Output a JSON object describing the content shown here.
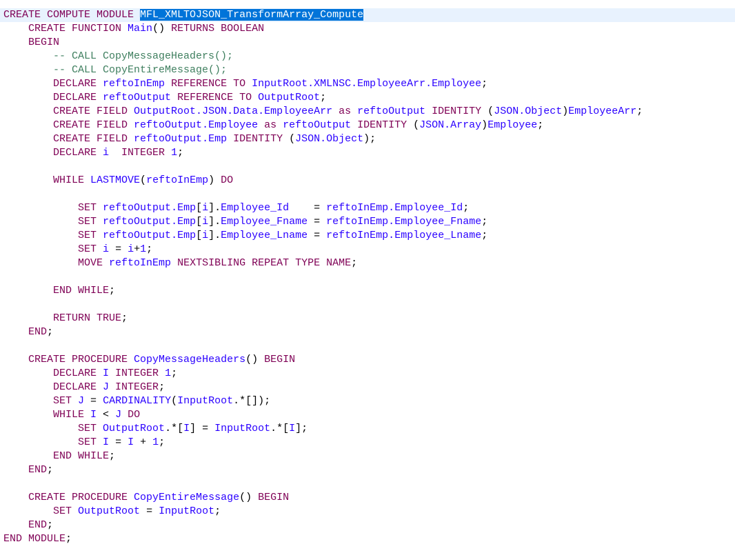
{
  "editor": {
    "language": "ESQL",
    "colors": {
      "keyword": "#7f0055",
      "identifier": "#2a00ff",
      "comment": "#3f7f5f",
      "punctuation": "#000000",
      "selection_bg": "#0074d9",
      "current_line_bg": "#e8f2fe"
    },
    "lines": [
      {
        "indent": 0,
        "current": true,
        "tokens": [
          [
            "kw",
            "CREATE COMPUTE MODULE "
          ],
          [
            "sel",
            "MFL_XMLTOJSON_TransformArray_Compute"
          ]
        ]
      },
      {
        "indent": 4,
        "tokens": [
          [
            "kw",
            "CREATE FUNCTION "
          ],
          [
            "id",
            "Main"
          ],
          [
            "pn",
            "() "
          ],
          [
            "kw",
            "RETURNS BOOLEAN"
          ]
        ]
      },
      {
        "indent": 4,
        "tokens": [
          [
            "kw",
            "BEGIN"
          ]
        ]
      },
      {
        "indent": 8,
        "tokens": [
          [
            "cm",
            "-- CALL CopyMessageHeaders();"
          ]
        ]
      },
      {
        "indent": 8,
        "tokens": [
          [
            "cm",
            "-- CALL CopyEntireMessage();"
          ]
        ]
      },
      {
        "indent": 8,
        "tokens": [
          [
            "kw",
            "DECLARE "
          ],
          [
            "id",
            "reftoInEmp "
          ],
          [
            "kw",
            "REFERENCE TO "
          ],
          [
            "id",
            "InputRoot.XMLNSC.EmployeeArr.Employee"
          ],
          [
            "pn",
            ";"
          ]
        ]
      },
      {
        "indent": 8,
        "tokens": [
          [
            "kw",
            "DECLARE "
          ],
          [
            "id",
            "reftoOutput "
          ],
          [
            "kw",
            "REFERENCE TO "
          ],
          [
            "id",
            "OutputRoot"
          ],
          [
            "pn",
            ";"
          ]
        ]
      },
      {
        "indent": 8,
        "tokens": [
          [
            "kw",
            "CREATE FIELD "
          ],
          [
            "id",
            "OutputRoot.JSON.Data.EmployeeArr "
          ],
          [
            "kw",
            "as "
          ],
          [
            "id",
            "reftoOutput "
          ],
          [
            "kw",
            "IDENTITY "
          ],
          [
            "pn",
            "("
          ],
          [
            "id",
            "JSON.Object"
          ],
          [
            "pn",
            ")"
          ],
          [
            "id",
            "EmployeeArr"
          ],
          [
            "pn",
            ";"
          ]
        ]
      },
      {
        "indent": 8,
        "tokens": [
          [
            "kw",
            "CREATE FIELD "
          ],
          [
            "id",
            "reftoOutput.Employee "
          ],
          [
            "kw",
            "as "
          ],
          [
            "id",
            "reftoOutput "
          ],
          [
            "kw",
            "IDENTITY "
          ],
          [
            "pn",
            "("
          ],
          [
            "id",
            "JSON.Array"
          ],
          [
            "pn",
            ")"
          ],
          [
            "id",
            "Employee"
          ],
          [
            "pn",
            ";"
          ]
        ]
      },
      {
        "indent": 8,
        "tokens": [
          [
            "kw",
            "CREATE FIELD "
          ],
          [
            "id",
            "reftoOutput.Emp "
          ],
          [
            "kw",
            "IDENTITY "
          ],
          [
            "pn",
            "("
          ],
          [
            "id",
            "JSON.Object"
          ],
          [
            "pn",
            ");"
          ]
        ]
      },
      {
        "indent": 8,
        "tokens": [
          [
            "kw",
            "DECLARE "
          ],
          [
            "id",
            "i  "
          ],
          [
            "kw",
            "INTEGER "
          ],
          [
            "num",
            "1"
          ],
          [
            "pn",
            ";"
          ]
        ]
      },
      {
        "indent": 0,
        "tokens": []
      },
      {
        "indent": 8,
        "tokens": [
          [
            "kw",
            "WHILE "
          ],
          [
            "id",
            "LASTMOVE"
          ],
          [
            "pn",
            "("
          ],
          [
            "id",
            "reftoInEmp"
          ],
          [
            "pn",
            ") "
          ],
          [
            "kw",
            "DO"
          ]
        ]
      },
      {
        "indent": 0,
        "tokens": []
      },
      {
        "indent": 12,
        "tokens": [
          [
            "kw",
            "SET "
          ],
          [
            "id",
            "reftoOutput.Emp"
          ],
          [
            "pn",
            "["
          ],
          [
            "id",
            "i"
          ],
          [
            "pn",
            "]."
          ],
          [
            "id",
            "Employee_Id    "
          ],
          [
            "pn",
            "= "
          ],
          [
            "id",
            "reftoInEmp.Employee_Id"
          ],
          [
            "pn",
            ";"
          ]
        ]
      },
      {
        "indent": 12,
        "tokens": [
          [
            "kw",
            "SET "
          ],
          [
            "id",
            "reftoOutput.Emp"
          ],
          [
            "pn",
            "["
          ],
          [
            "id",
            "i"
          ],
          [
            "pn",
            "]."
          ],
          [
            "id",
            "Employee_Fname "
          ],
          [
            "pn",
            "= "
          ],
          [
            "id",
            "reftoInEmp.Employee_Fname"
          ],
          [
            "pn",
            ";"
          ]
        ]
      },
      {
        "indent": 12,
        "tokens": [
          [
            "kw",
            "SET "
          ],
          [
            "id",
            "reftoOutput.Emp"
          ],
          [
            "pn",
            "["
          ],
          [
            "id",
            "i"
          ],
          [
            "pn",
            "]."
          ],
          [
            "id",
            "Employee_Lname "
          ],
          [
            "pn",
            "= "
          ],
          [
            "id",
            "reftoInEmp.Employee_Lname"
          ],
          [
            "pn",
            ";"
          ]
        ]
      },
      {
        "indent": 12,
        "tokens": [
          [
            "kw",
            "SET "
          ],
          [
            "id",
            "i "
          ],
          [
            "pn",
            "= "
          ],
          [
            "id",
            "i"
          ],
          [
            "pn",
            "+"
          ],
          [
            "num",
            "1"
          ],
          [
            "pn",
            ";"
          ]
        ]
      },
      {
        "indent": 12,
        "tokens": [
          [
            "kw",
            "MOVE "
          ],
          [
            "id",
            "reftoInEmp "
          ],
          [
            "kw",
            "NEXTSIBLING REPEAT TYPE NAME"
          ],
          [
            "pn",
            ";"
          ]
        ]
      },
      {
        "indent": 0,
        "tokens": []
      },
      {
        "indent": 8,
        "tokens": [
          [
            "kw",
            "END WHILE"
          ],
          [
            "pn",
            ";"
          ]
        ]
      },
      {
        "indent": 0,
        "tokens": []
      },
      {
        "indent": 8,
        "tokens": [
          [
            "kw",
            "RETURN TRUE"
          ],
          [
            "pn",
            ";"
          ]
        ]
      },
      {
        "indent": 4,
        "tokens": [
          [
            "kw",
            "END"
          ],
          [
            "pn",
            ";"
          ]
        ]
      },
      {
        "indent": 0,
        "tokens": []
      },
      {
        "indent": 4,
        "tokens": [
          [
            "kw",
            "CREATE PROCEDURE "
          ],
          [
            "id",
            "CopyMessageHeaders"
          ],
          [
            "pn",
            "() "
          ],
          [
            "kw",
            "BEGIN"
          ]
        ]
      },
      {
        "indent": 8,
        "tokens": [
          [
            "kw",
            "DECLARE "
          ],
          [
            "id",
            "I "
          ],
          [
            "kw",
            "INTEGER "
          ],
          [
            "num",
            "1"
          ],
          [
            "pn",
            ";"
          ]
        ]
      },
      {
        "indent": 8,
        "tokens": [
          [
            "kw",
            "DECLARE "
          ],
          [
            "id",
            "J "
          ],
          [
            "kw",
            "INTEGER"
          ],
          [
            "pn",
            ";"
          ]
        ]
      },
      {
        "indent": 8,
        "tokens": [
          [
            "kw",
            "SET "
          ],
          [
            "id",
            "J "
          ],
          [
            "pn",
            "= "
          ],
          [
            "id",
            "CARDINALITY"
          ],
          [
            "pn",
            "("
          ],
          [
            "id",
            "InputRoot"
          ],
          [
            "pn",
            ".*[]);"
          ]
        ]
      },
      {
        "indent": 8,
        "tokens": [
          [
            "kw",
            "WHILE "
          ],
          [
            "id",
            "I "
          ],
          [
            "pn",
            "< "
          ],
          [
            "id",
            "J "
          ],
          [
            "kw",
            "DO"
          ]
        ]
      },
      {
        "indent": 12,
        "tokens": [
          [
            "kw",
            "SET "
          ],
          [
            "id",
            "OutputRoot"
          ],
          [
            "pn",
            ".*["
          ],
          [
            "id",
            "I"
          ],
          [
            "pn",
            "] = "
          ],
          [
            "id",
            "InputRoot"
          ],
          [
            "pn",
            ".*["
          ],
          [
            "id",
            "I"
          ],
          [
            "pn",
            "];"
          ]
        ]
      },
      {
        "indent": 12,
        "tokens": [
          [
            "kw",
            "SET "
          ],
          [
            "id",
            "I "
          ],
          [
            "pn",
            "= "
          ],
          [
            "id",
            "I "
          ],
          [
            "pn",
            "+ "
          ],
          [
            "num",
            "1"
          ],
          [
            "pn",
            ";"
          ]
        ]
      },
      {
        "indent": 8,
        "tokens": [
          [
            "kw",
            "END WHILE"
          ],
          [
            "pn",
            ";"
          ]
        ]
      },
      {
        "indent": 4,
        "tokens": [
          [
            "kw",
            "END"
          ],
          [
            "pn",
            ";"
          ]
        ]
      },
      {
        "indent": 0,
        "tokens": []
      },
      {
        "indent": 4,
        "tokens": [
          [
            "kw",
            "CREATE PROCEDURE "
          ],
          [
            "id",
            "CopyEntireMessage"
          ],
          [
            "pn",
            "() "
          ],
          [
            "kw",
            "BEGIN"
          ]
        ]
      },
      {
        "indent": 8,
        "tokens": [
          [
            "kw",
            "SET "
          ],
          [
            "id",
            "OutputRoot "
          ],
          [
            "pn",
            "= "
          ],
          [
            "id",
            "InputRoot"
          ],
          [
            "pn",
            ";"
          ]
        ]
      },
      {
        "indent": 4,
        "tokens": [
          [
            "kw",
            "END"
          ],
          [
            "pn",
            ";"
          ]
        ]
      },
      {
        "indent": 0,
        "tokens": [
          [
            "kw",
            "END MODULE"
          ],
          [
            "pn",
            ";"
          ]
        ]
      }
    ]
  }
}
